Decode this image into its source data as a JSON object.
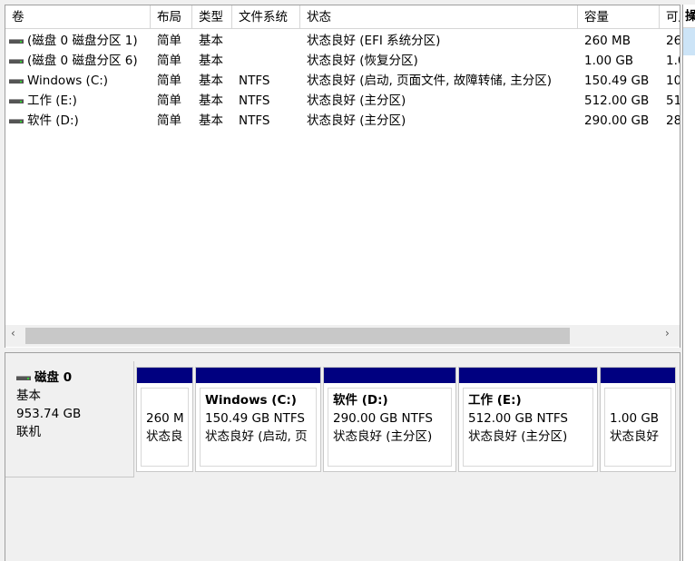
{
  "columns": [
    "卷",
    "布局",
    "类型",
    "文件系统",
    "状态",
    "容量",
    "可用"
  ],
  "volumes": [
    {
      "name": "(磁盘 0 磁盘分区 1)",
      "layout": "简单",
      "type": "基本",
      "fs": "",
      "status": "状态良好 (EFI 系统分区)",
      "capacity": "260 MB",
      "free": "26"
    },
    {
      "name": "(磁盘 0 磁盘分区 6)",
      "layout": "简单",
      "type": "基本",
      "fs": "",
      "status": "状态良好 (恢复分区)",
      "capacity": "1.00 GB",
      "free": "1.0"
    },
    {
      "name": "Windows (C:)",
      "layout": "简单",
      "type": "基本",
      "fs": "NTFS",
      "status": "状态良好 (启动, 页面文件, 故障转储, 主分区)",
      "capacity": "150.49 GB",
      "free": "10"
    },
    {
      "name": "工作 (E:)",
      "layout": "简单",
      "type": "基本",
      "fs": "NTFS",
      "status": "状态良好 (主分区)",
      "capacity": "512.00 GB",
      "free": "51"
    },
    {
      "name": "软件 (D:)",
      "layout": "简单",
      "type": "基本",
      "fs": "NTFS",
      "status": "状态良好 (主分区)",
      "capacity": "290.00 GB",
      "free": "28"
    }
  ],
  "scroll": {
    "left": "‹",
    "right": "›"
  },
  "disk": {
    "name": "磁盘 0",
    "type": "基本",
    "size": "953.74 GB",
    "state": "联机"
  },
  "partitions": [
    {
      "title": "",
      "size": "260 M",
      "status": "状态良"
    },
    {
      "title": "Windows  (C:)",
      "size": "150.49 GB NTFS",
      "status": "状态良好 (启动, 页"
    },
    {
      "title": "软件  (D:)",
      "size": "290.00 GB NTFS",
      "status": "状态良好 (主分区)"
    },
    {
      "title": "工作  (E:)",
      "size": "512.00 GB NTFS",
      "status": "状态良好 (主分区)"
    },
    {
      "title": "",
      "size": "1.00 GB",
      "status": "状态良好"
    }
  ],
  "actions_header": "操",
  "colors": {
    "partition_bar": "#000080",
    "selection": "#cce4f7"
  }
}
